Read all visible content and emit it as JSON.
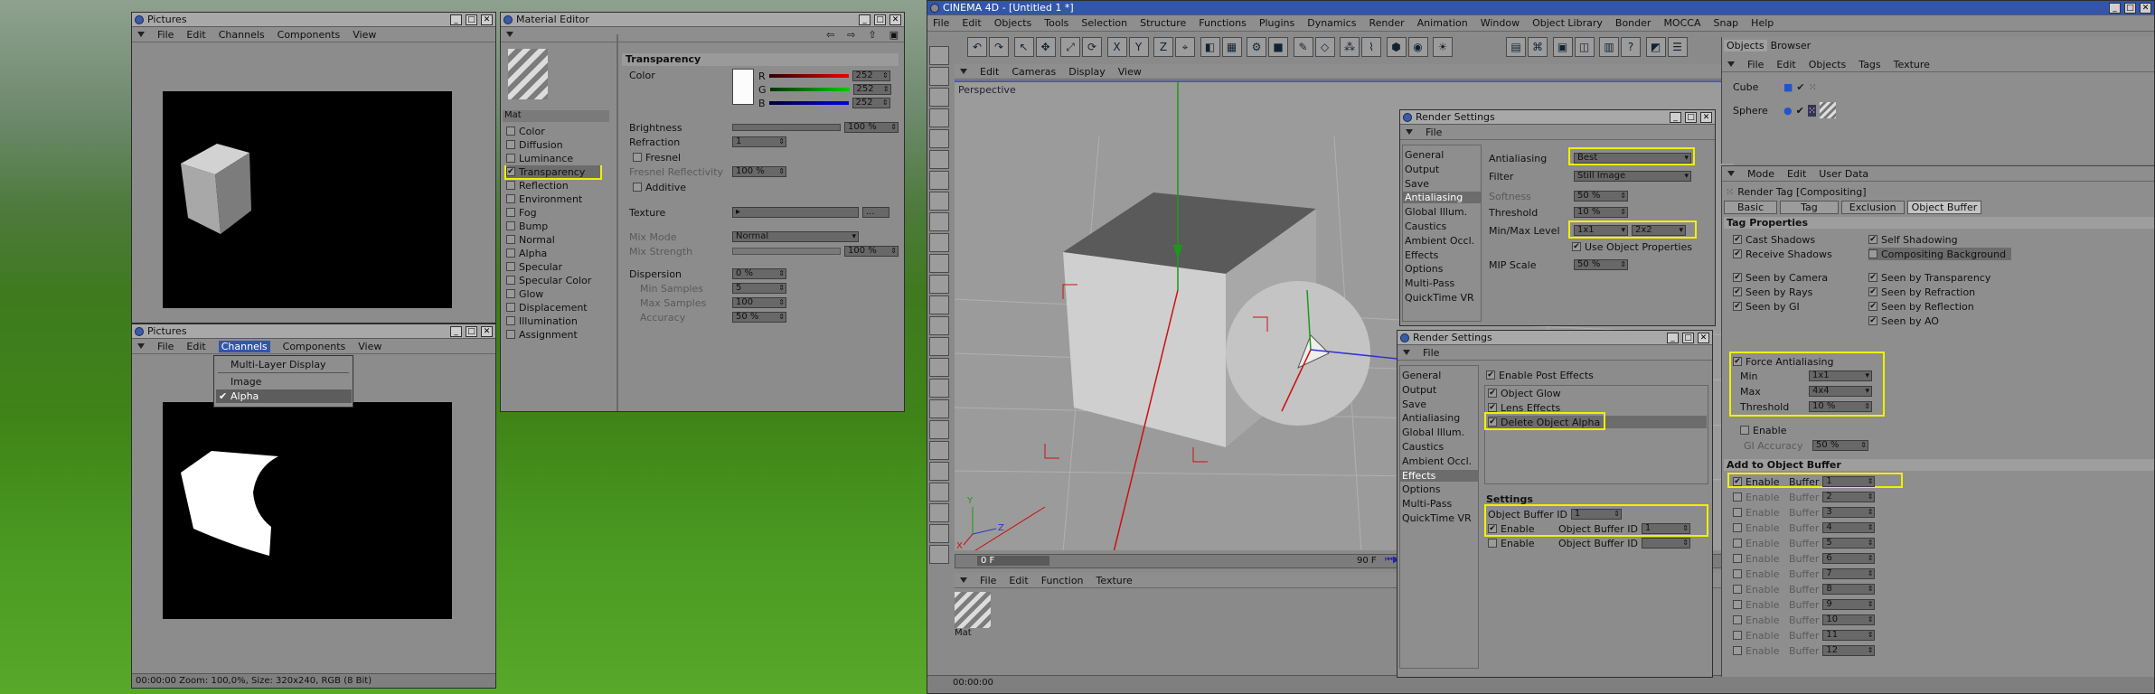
{
  "pictures_top": {
    "title": "Pictures",
    "menu": [
      "File",
      "Edit",
      "Channels",
      "Components",
      "View"
    ]
  },
  "pictures_bottom": {
    "title": "Pictures",
    "menu": [
      "File",
      "Edit",
      "Channels",
      "Components",
      "View"
    ],
    "dropdown": [
      "Multi-Layer Display",
      "Image",
      "Alpha"
    ],
    "status": "00:00:00  Zoom: 100,0%, Size: 320x240, RGB (8 Bit)"
  },
  "material_editor": {
    "title": "Material Editor",
    "mat_label": "Mat",
    "channels": [
      "Color",
      "Diffusion",
      "Luminance",
      "Transparency",
      "Reflection",
      "Environment",
      "Fog",
      "Bump",
      "Normal",
      "Alpha",
      "Specular",
      "Specular Color",
      "Glow",
      "Displacement",
      "Illumination",
      "Assignment"
    ],
    "section": "Transparency",
    "color_label": "Color",
    "r": "R",
    "g": "G",
    "b": "B",
    "r_val": "252",
    "g_val": "252",
    "b_val": "252",
    "brightness_label": "Brightness",
    "brightness_val": "100 %",
    "refraction_label": "Refraction",
    "refraction_val": "1",
    "fresnel": "Fresnel",
    "fresnel_refl": "Fresnel Reflectivity",
    "fresnel_refl_val": "100 %",
    "additive": "Additive",
    "texture": "Texture",
    "mix_mode": "Mix Mode",
    "mix_mode_val": "Normal",
    "mix_strength": "Mix Strength",
    "mix_strength_val": "100 %",
    "dispersion": "Dispersion",
    "dispersion_val": "0 %",
    "min_samples": "Min Samples",
    "min_samples_val": "5",
    "max_samples": "Max Samples",
    "max_samples_val": "100",
    "accuracy": "Accuracy",
    "accuracy_val": "50 %"
  },
  "c4d": {
    "title": "CINEMA 4D - [Untitled 1 *]",
    "menu": [
      "File",
      "Edit",
      "Objects",
      "Tools",
      "Selection",
      "Structure",
      "Functions",
      "Plugins",
      "Dynamics",
      "Render",
      "Animation",
      "Window",
      "Object Library",
      "Bonder",
      "MOCCA",
      "Snap",
      "Help"
    ],
    "view_menu": [
      "Edit",
      "Cameras",
      "Display",
      "View"
    ],
    "viewport_label": "Perspective",
    "timeline_start": "0 F",
    "timeline_end": "90 F",
    "mat_menu": [
      "File",
      "Edit",
      "Function",
      "Texture"
    ],
    "mat_label": "Mat",
    "time": "00:00:00"
  },
  "render_settings_1": {
    "title": "Render Settings",
    "menu": "File",
    "sidebar": [
      "General",
      "Output",
      "Save",
      "Antialiasing",
      "Global Illum.",
      "Caustics",
      "Ambient Occl.",
      "Effects",
      "Options",
      "Multi-Pass",
      "QuickTime VR"
    ],
    "antialiasing": "Antialiasing",
    "antialiasing_val": "Best",
    "filter": "Filter",
    "filter_val": "Still Image",
    "softness": "Softness",
    "softness_val": "50 %",
    "threshold": "Threshold",
    "threshold_val": "10 %",
    "minmax": "Min/Max Level",
    "min_val": "1x1",
    "max_val": "2x2",
    "use_obj": "Use Object Properties",
    "mip": "MIP Scale",
    "mip_val": "50 %"
  },
  "render_settings_2": {
    "title": "Render Settings",
    "menu": "File",
    "sidebar": [
      "General",
      "Output",
      "Save",
      "Antialiasing",
      "Global Illum.",
      "Caustics",
      "Ambient Occl.",
      "Effects",
      "Options",
      "Multi-Pass",
      "QuickTime VR"
    ],
    "enable_post": "Enable Post Effects",
    "effects": [
      "Object Glow",
      "Lens Effects",
      "Delete Object Alpha"
    ],
    "settings": "Settings",
    "obj_buf": "Object Buffer ID",
    "obj_buf_val": "1",
    "enable": "Enable",
    "buf_id": "Object Buffer ID",
    "buf1": "1",
    "buf2": ""
  },
  "objects": {
    "tabs": [
      "Objects",
      "Browser"
    ],
    "menu": [
      "File",
      "Edit",
      "Objects",
      "Tags",
      "Texture"
    ],
    "items": [
      "Cube",
      "Sphere"
    ]
  },
  "attributes": {
    "menu": [
      "Mode",
      "Edit",
      "User Data"
    ],
    "title": "Render Tag [Compositing]",
    "tabs": [
      "Basic",
      "Tag",
      "Exclusion",
      "Object Buffer"
    ],
    "tag_props": "Tag Properties",
    "left_opts": [
      "Cast Shadows",
      "Receive Shadows",
      "Seen by Camera",
      "Seen by Rays",
      "Seen by GI"
    ],
    "right_opts": [
      "Self Shadowing",
      "Compositing Background",
      "Seen by Transparency",
      "Seen by Refraction",
      "Seen by Reflection",
      "Seen by AO"
    ],
    "force_aa": "Force Antialiasing",
    "min": "Min",
    "min_val": "1x1",
    "max": "Max",
    "max_val": "4x4",
    "threshold": "Threshold",
    "threshold_val": "10 %",
    "enable": "Enable",
    "gi_acc": "GI Accuracy",
    "gi_acc_val": "50 %",
    "add_buffer": "Add to Object Buffer",
    "buffer_label": "Buffer",
    "buffers": [
      "1",
      "2",
      "3",
      "4",
      "5",
      "6",
      "7",
      "8",
      "9",
      "10",
      "11",
      "12"
    ]
  }
}
